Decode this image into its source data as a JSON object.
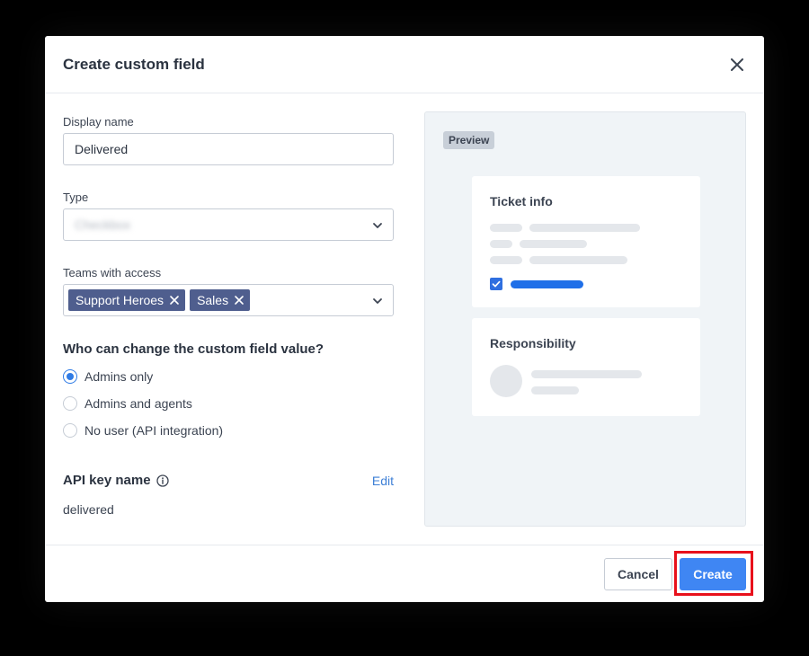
{
  "modal": {
    "title": "Create custom field"
  },
  "form": {
    "display_name": {
      "label": "Display name",
      "value": "Delivered"
    },
    "type": {
      "label": "Type",
      "value": "Checkbox"
    },
    "teams": {
      "label": "Teams with access",
      "tags": [
        "Support Heroes",
        "Sales"
      ]
    },
    "permissions": {
      "title": "Who can change the custom field value?",
      "options": [
        "Admins only",
        "Admins and agents",
        "No user (API integration)"
      ],
      "selected": "Admins only"
    },
    "api_key": {
      "title": "API key name",
      "edit_label": "Edit",
      "value": "delivered"
    }
  },
  "preview": {
    "badge": "Preview",
    "ticket_card_title": "Ticket info",
    "responsibility_card_title": "Responsibility"
  },
  "footer": {
    "cancel_label": "Cancel",
    "create_label": "Create"
  },
  "colors": {
    "primary": "#3f86f3",
    "tag": "#4f5e8e",
    "highlight": "#e8101b"
  }
}
